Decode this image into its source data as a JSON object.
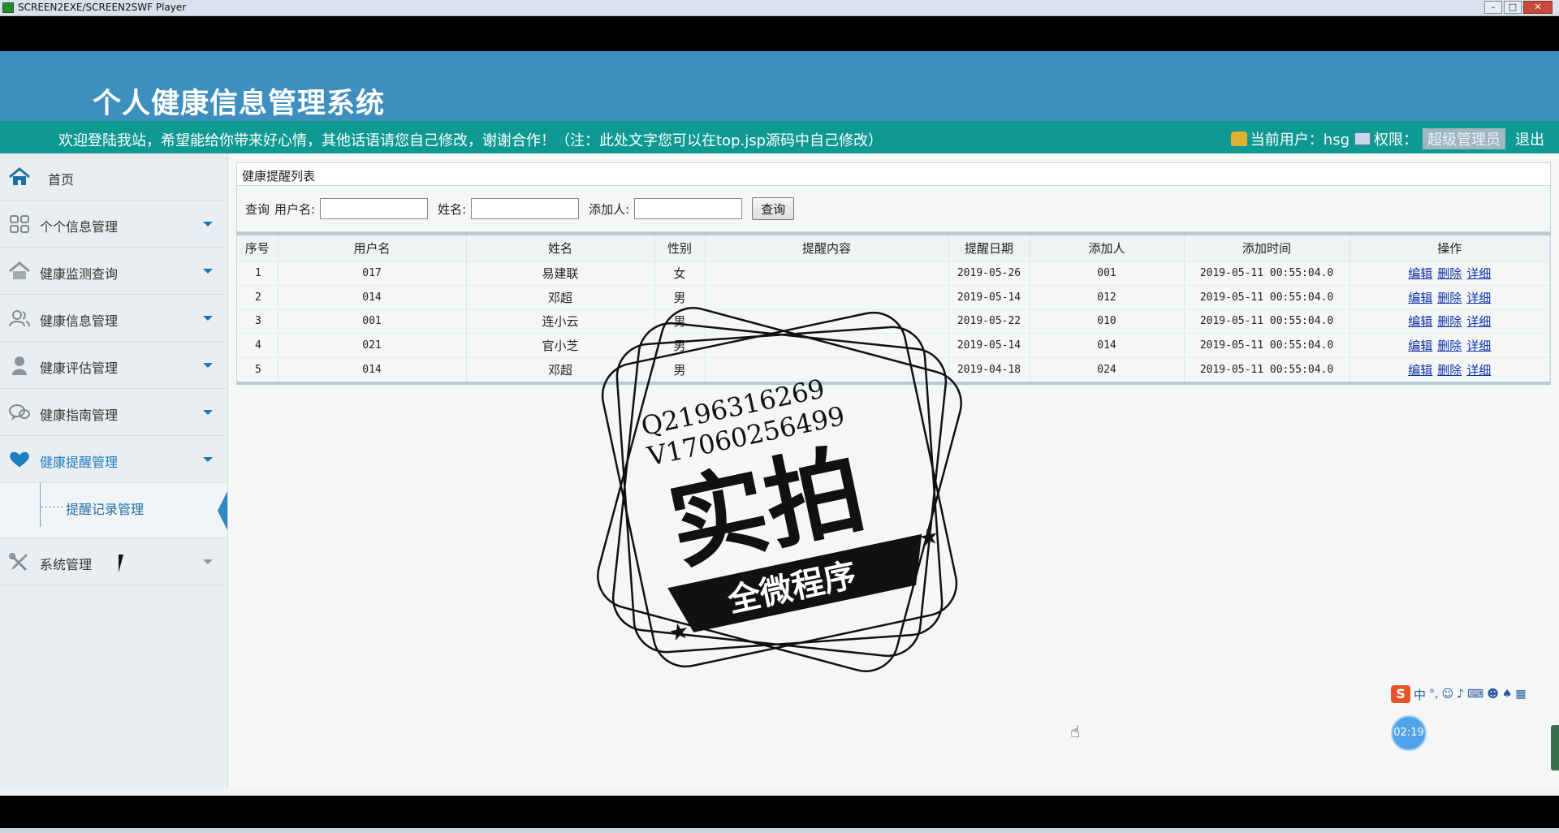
{
  "player": {
    "title": "SCREEN2EXE/SCREEN2SWF Player",
    "min_label": "–",
    "max_label": "□",
    "close_label": "✕"
  },
  "header": {
    "site_title": "个人健康信息管理系统",
    "welcome": "欢迎登陆我站，希望能给你带来好心情，其他话语请您自己修改，谢谢合作！（注：此处文字您可以在top.jsp源码中自己修改）",
    "current_user_label": "当前用户：hsg",
    "permission_label": "权限：",
    "role": "超级管理员",
    "logout": "退出"
  },
  "sidebar": {
    "home": "首页",
    "items": [
      {
        "label": "个个信息管理",
        "icon": "grid-icon"
      },
      {
        "label": "健康监测查询",
        "icon": "home-outline-icon"
      },
      {
        "label": "健康信息管理",
        "icon": "users-icon"
      },
      {
        "label": "健康评估管理",
        "icon": "person-icon"
      },
      {
        "label": "健康指南管理",
        "icon": "chat-icon"
      },
      {
        "label": "健康提醒管理",
        "icon": "heart-icon"
      }
    ],
    "sub_item": "提醒记录管理",
    "system": "系统管理"
  },
  "main": {
    "panel_title": "健康提醒列表",
    "search": {
      "query_label": "查询",
      "username_label": "用户名:",
      "name_label": "姓名:",
      "adder_label": "添加人:",
      "username_value": "",
      "name_value": "",
      "adder_value": "",
      "button": "查询"
    },
    "columns": [
      "序号",
      "用户名",
      "姓名",
      "性别",
      "提醒内容",
      "提醒日期",
      "添加人",
      "添加时间",
      "操作"
    ],
    "rows": [
      {
        "idx": "1",
        "username": "017",
        "name": "易建联",
        "gender": "女",
        "content": "",
        "date": "2019-05-26",
        "adder": "001",
        "time": "2019-05-11 00:55:04.0"
      },
      {
        "idx": "2",
        "username": "014",
        "name": "邓超",
        "gender": "男",
        "content": "",
        "date": "2019-05-14",
        "adder": "012",
        "time": "2019-05-11 00:55:04.0"
      },
      {
        "idx": "3",
        "username": "001",
        "name": "连小云",
        "gender": "男",
        "content": "",
        "date": "2019-05-22",
        "adder": "010",
        "time": "2019-05-11 00:55:04.0"
      },
      {
        "idx": "4",
        "username": "021",
        "name": "官小芝",
        "gender": "男",
        "content": "",
        "date": "2019-05-14",
        "adder": "014",
        "time": "2019-05-11 00:55:04.0"
      },
      {
        "idx": "5",
        "username": "014",
        "name": "邓超",
        "gender": "男",
        "content": "",
        "date": "2019-04-18",
        "adder": "024",
        "time": "2019-05-11 00:55:04.0"
      }
    ],
    "ops": {
      "edit": "编辑",
      "delete": "删除",
      "detail": "详细"
    }
  },
  "overlay": {
    "ime_logo": "S",
    "ime_mode": "中",
    "timer": "02:19",
    "watermark_phone1": "Q2196316269",
    "watermark_phone2": "V17060256499",
    "watermark_main": "实拍",
    "watermark_sub": "全微程序"
  }
}
